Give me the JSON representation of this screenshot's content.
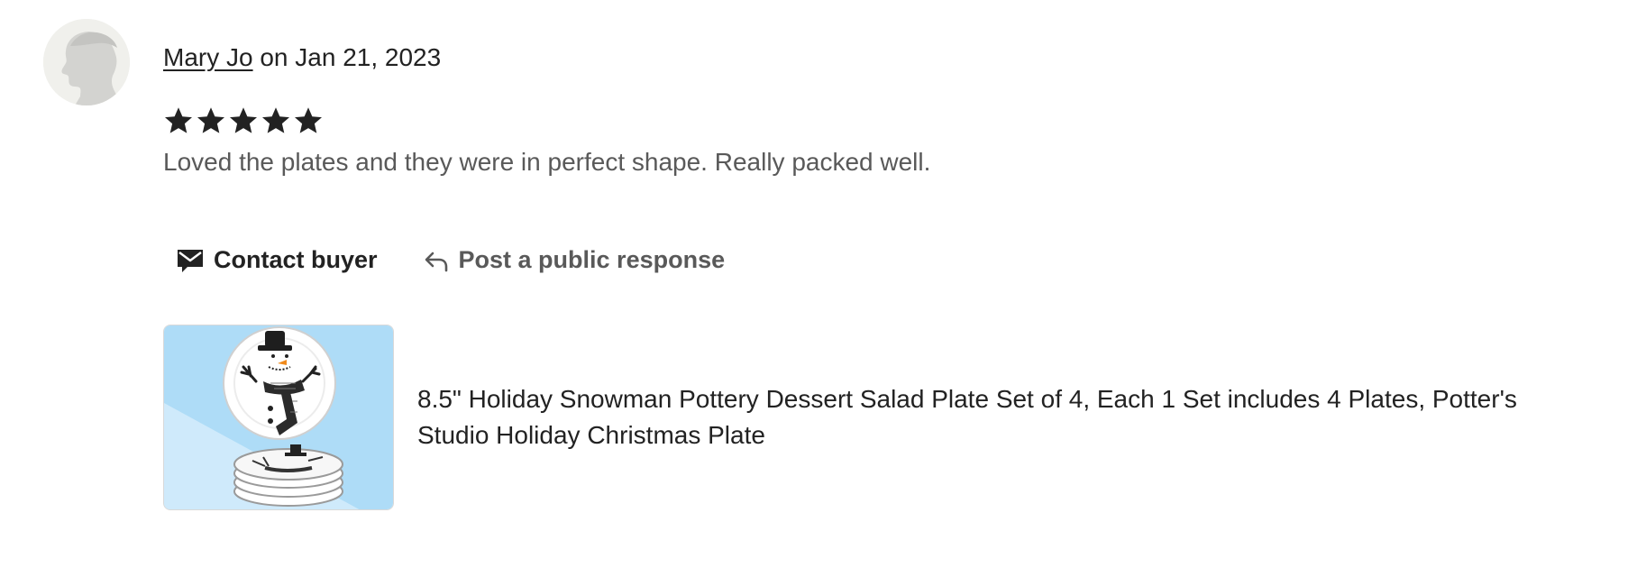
{
  "review": {
    "reviewer_name": "Mary Jo",
    "date_text": "on Jan 21, 2023",
    "rating": 5,
    "rating_max": 5,
    "text": "Loved the plates and they were in perfect shape. Really packed well."
  },
  "actions": {
    "contact_label": "Contact buyer",
    "contact_icon": "envelope-icon",
    "respond_label": "Post a public response",
    "respond_icon": "reply-arrow-icon"
  },
  "listing": {
    "title": "8.5\" Holiday Snowman Pottery Dessert Salad Plate Set of 4, Each 1 Set includes 4 Plates, Potter's Studio Holiday Christmas Plate"
  },
  "colors": {
    "text_primary": "#222222",
    "text_secondary": "#595959",
    "avatar_bg": "#f0f0ec",
    "thumb_bg": "#aedcf7"
  }
}
